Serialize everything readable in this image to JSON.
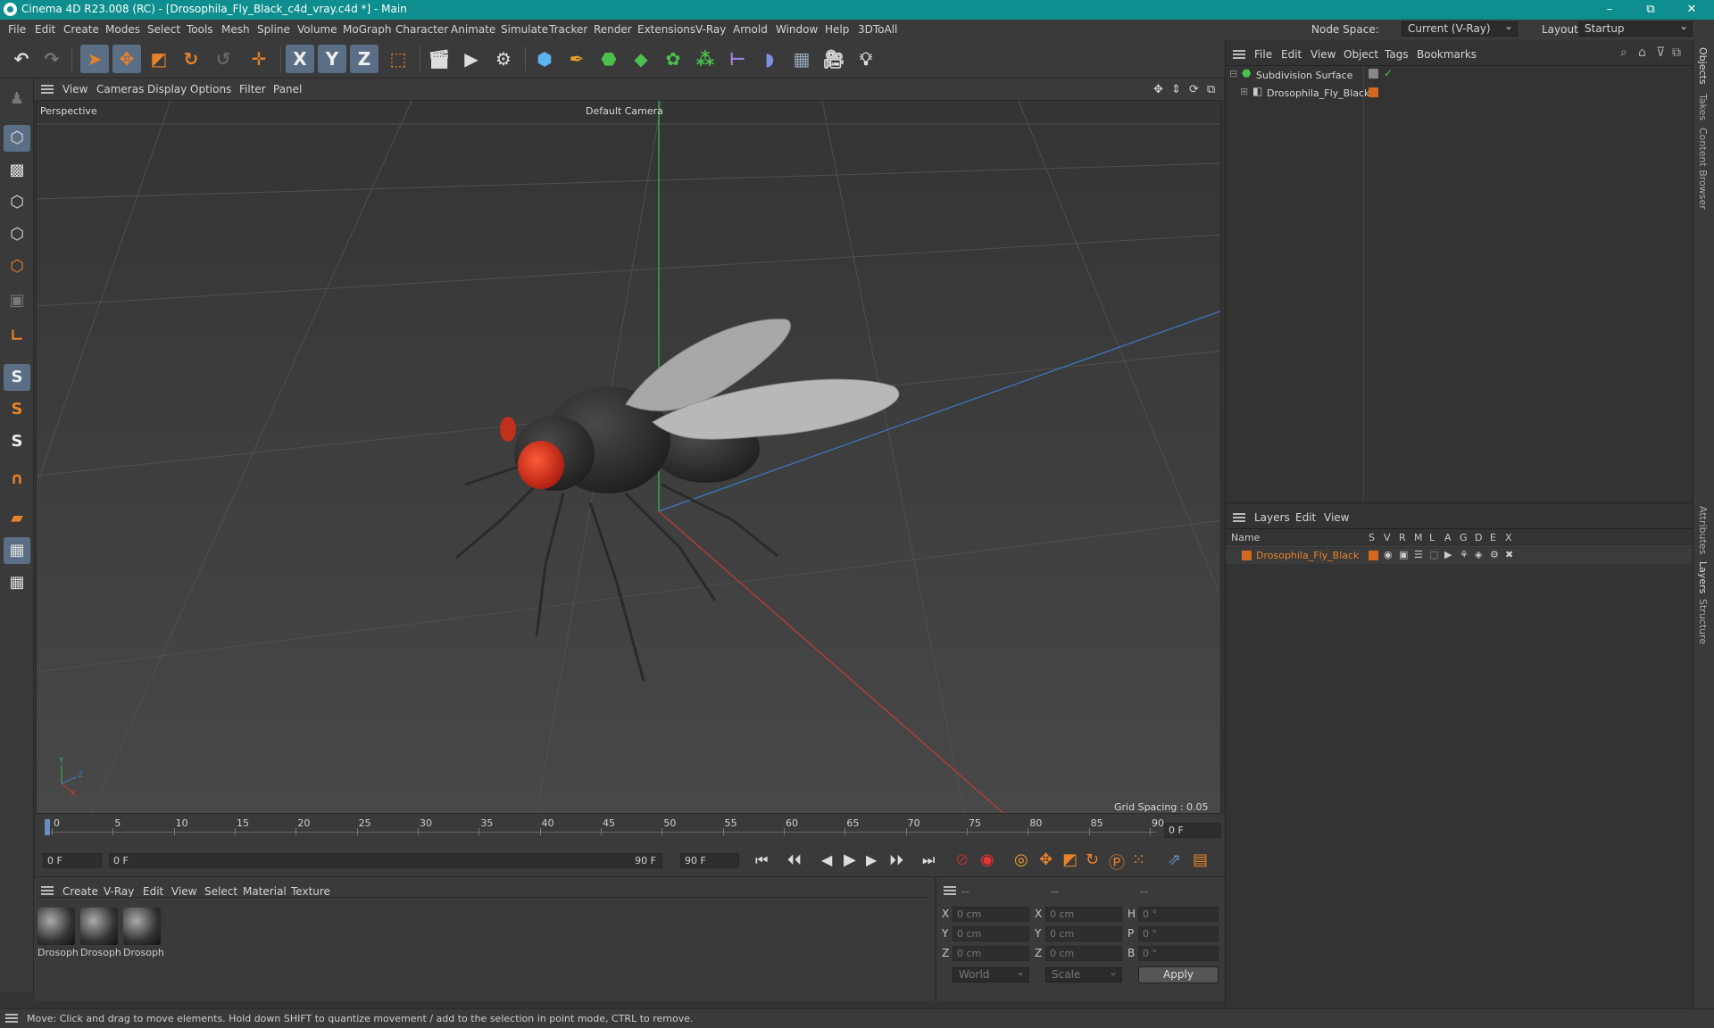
{
  "window": {
    "title": "Cinema 4D R23.008 (RC) - [Drosophila_Fly_Black_c4d_vray.c4d *] - Main",
    "minimize": "–",
    "restore": "⧉",
    "close": "✕"
  },
  "menubar": {
    "items": [
      "File",
      "Edit",
      "Create",
      "Modes",
      "Select",
      "Tools",
      "Mesh",
      "Spline",
      "Volume",
      "MoGraph",
      "Character",
      "Animate",
      "Simulate",
      "Tracker",
      "Render",
      "Extensions",
      "V-Ray",
      "Arnold",
      "Window",
      "Help",
      "3DToAll"
    ],
    "node_space_label": "Node Space:",
    "node_space_value": "Current (V-Ray)",
    "layout_label": "Layout:",
    "layout_value": "Startup"
  },
  "toolbar": {
    "axis_x": "X",
    "axis_y": "Y",
    "axis_z": "Z"
  },
  "lefttools": {
    "snap_s1": "S",
    "snap_s2": "S",
    "snap_s3": "S"
  },
  "viewport_menu": {
    "items": [
      "View",
      "Cameras",
      "Display",
      "Options",
      "Filter",
      "Panel"
    ]
  },
  "viewport": {
    "label": "Perspective",
    "camera": "Default Camera",
    "grid_spacing": "Grid Spacing : 0.05 cm",
    "axis_y": "Y",
    "axis_z": "Z",
    "axis_x": "X"
  },
  "timeline": {
    "ticks": [
      "0",
      "5",
      "10",
      "15",
      "20",
      "25",
      "30",
      "35",
      "40",
      "45",
      "50",
      "55",
      "60",
      "65",
      "70",
      "75",
      "80",
      "85",
      "90"
    ],
    "current_frame": "0 F"
  },
  "transport": {
    "start_frame": "0 F",
    "range_start": "0 F",
    "range_end": "90 F",
    "end_frame": "90 F"
  },
  "materials": {
    "menu": [
      "Create",
      "V-Ray",
      "Edit",
      "View",
      "Select",
      "Material",
      "Texture"
    ],
    "items": [
      "Drosoph",
      "Drosoph",
      "Drosoph"
    ]
  },
  "coords": {
    "header": [
      "--",
      "--",
      "--"
    ],
    "row_labels": [
      "X",
      "Y",
      "Z"
    ],
    "size_labels": [
      "X",
      "Y",
      "Z"
    ],
    "rot_labels": [
      "H",
      "P",
      "B"
    ],
    "pos_values": [
      "0 cm",
      "0 cm",
      "0 cm"
    ],
    "size_values": [
      "0 cm",
      "0 cm",
      "0 cm"
    ],
    "rot_values": [
      "0 °",
      "0 °",
      "0 °"
    ],
    "mode_world": "World",
    "mode_scale": "Scale",
    "apply": "Apply"
  },
  "objects": {
    "menu": [
      "File",
      "Edit",
      "View",
      "Object",
      "Tags",
      "Bookmarks"
    ],
    "tree": [
      {
        "name": "Subdivision Surface"
      },
      {
        "name": "Drosophila_Fly_Black"
      }
    ]
  },
  "layers": {
    "menu": [
      "Layers",
      "Edit",
      "View"
    ],
    "col_name": "Name",
    "cols": [
      "S",
      "V",
      "R",
      "M",
      "L",
      "A",
      "G",
      "D",
      "E",
      "X"
    ],
    "rows": [
      {
        "name": "Drosophila_Fly_Black",
        "color": "#d2691e"
      }
    ]
  },
  "right_tabs": [
    "Objects",
    "Takes",
    "Content Browser",
    "Attributes",
    "Layers",
    "Structure"
  ],
  "status": {
    "text": "Move: Click and drag to move elements. Hold down SHIFT to quantize movement / add to the selection in point mode, CTRL to remove."
  },
  "colors": {
    "titlebar": "#0e8e8e",
    "selected_tool": "#5a6f86",
    "accent_orange": "#e8822a",
    "fly_eye": "#e03a1e"
  }
}
